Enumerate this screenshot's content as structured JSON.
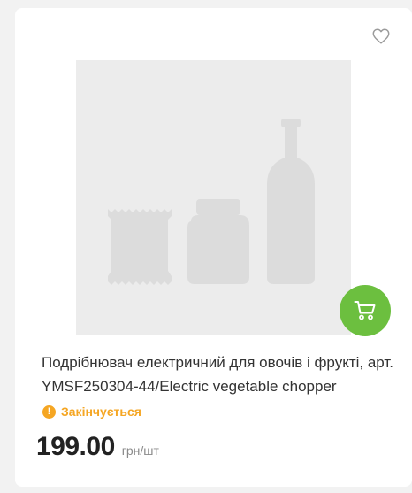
{
  "product": {
    "title": "Подрібнювач електричний для овочів і фрукті, арт.YMSF250304-44/Electric vegetable chopper",
    "status": "Закінчується",
    "price": "199.00",
    "unit": "грн/шт"
  },
  "icons": {
    "favorite": "heart-outline-icon",
    "cart": "shopping-cart-icon",
    "status": "exclamation-circle-icon"
  },
  "colors": {
    "cart_button": "#6cbf3f",
    "status": "#f5a623",
    "placeholder_bg": "#ececec"
  }
}
